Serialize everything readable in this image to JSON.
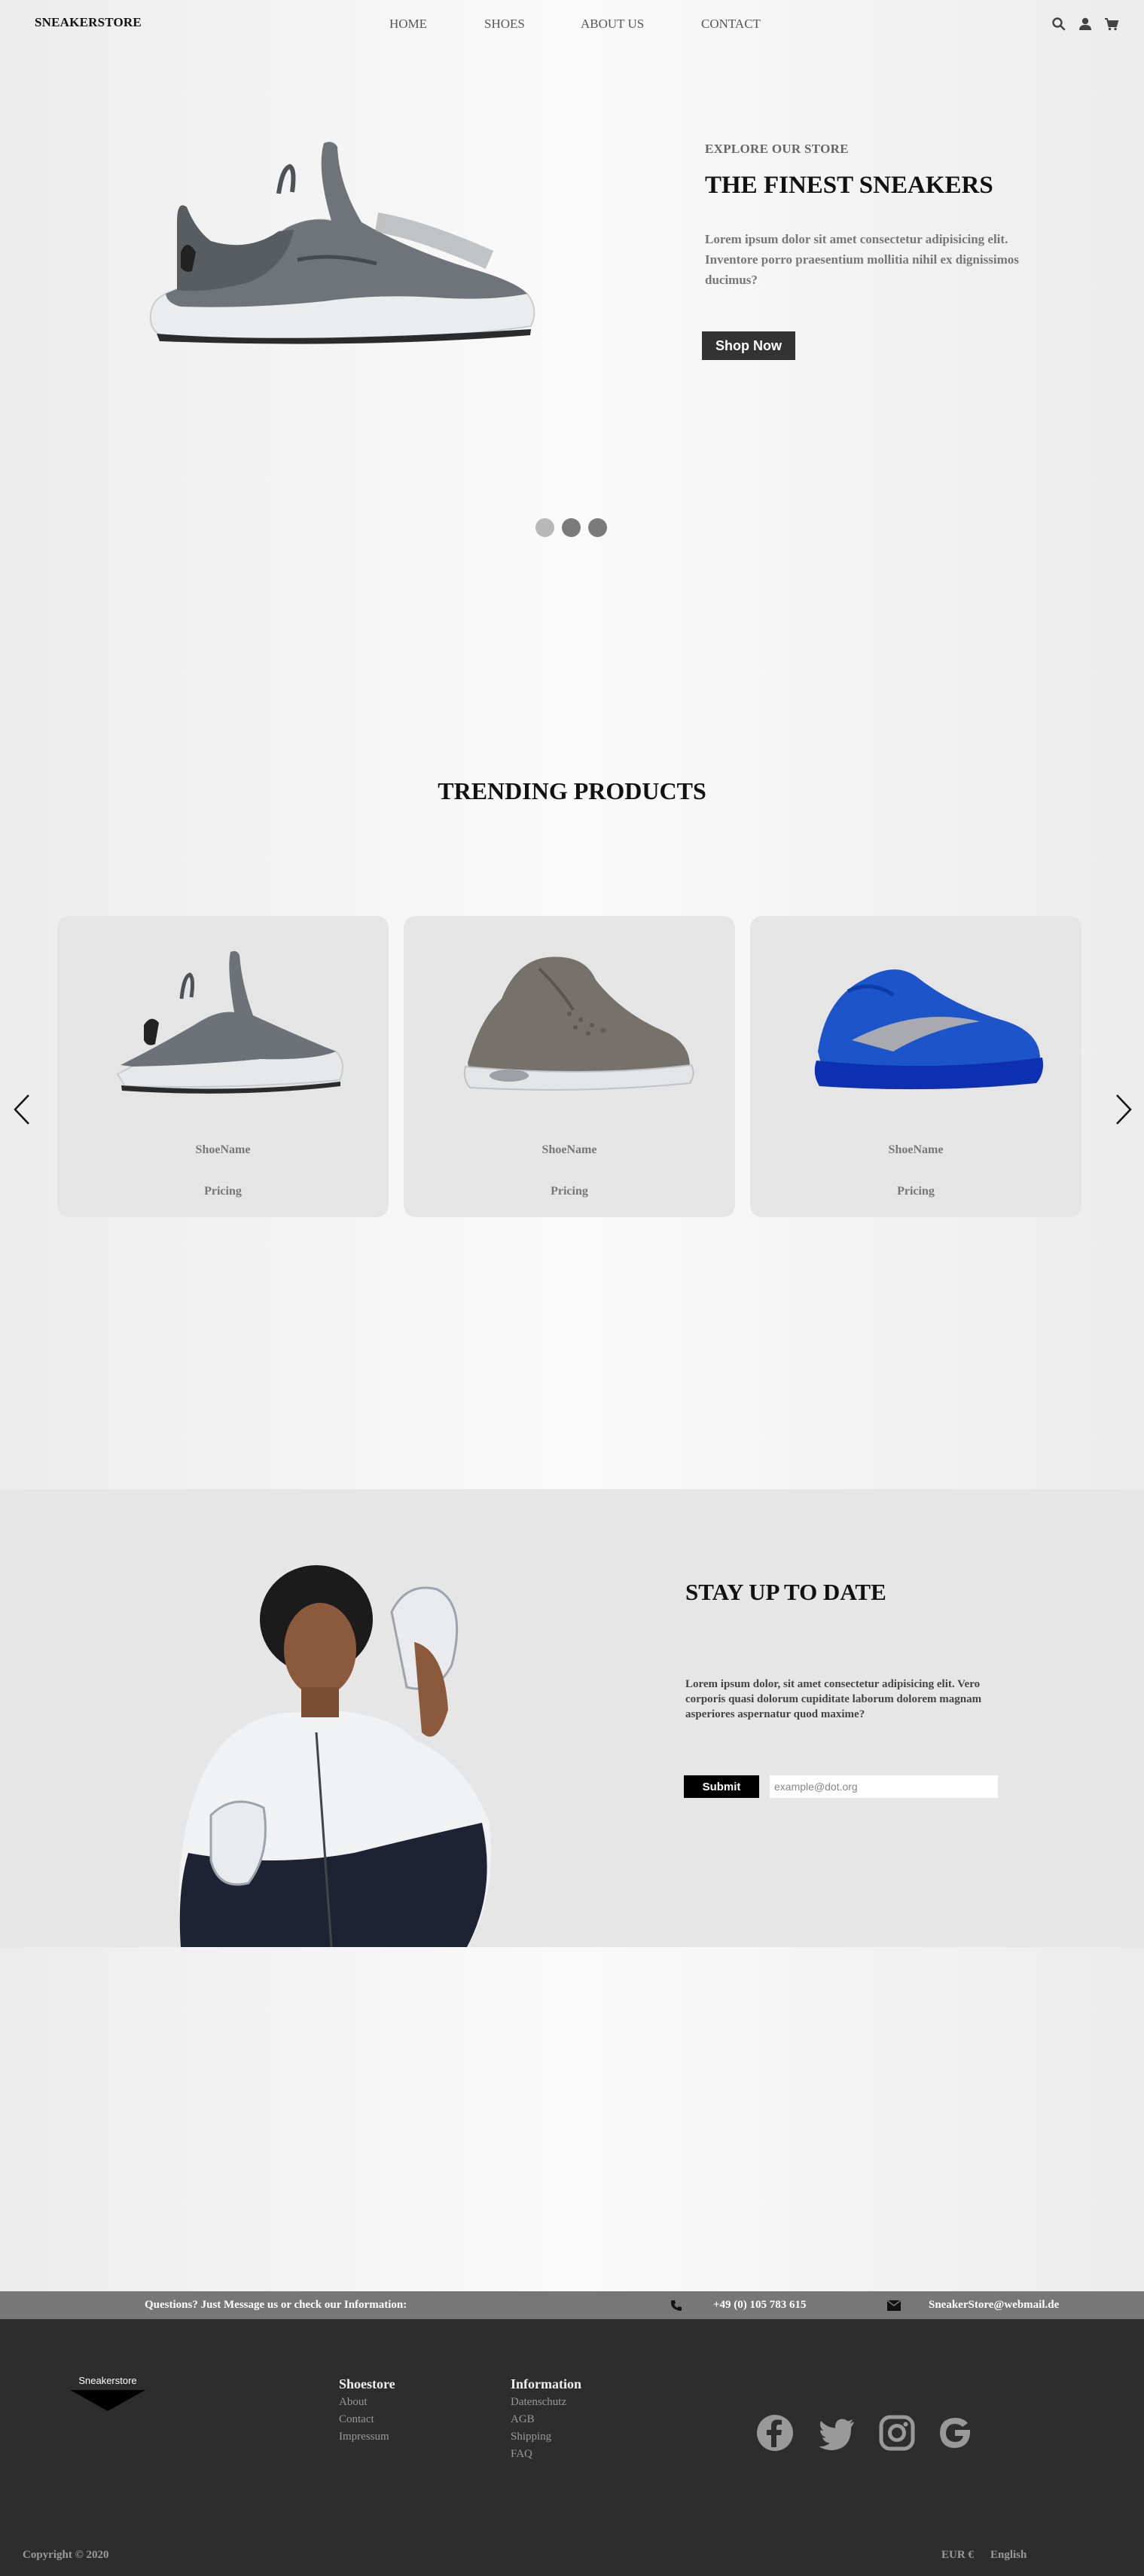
{
  "header": {
    "logo": "SNEAKERSTORE",
    "nav": [
      "HOME",
      "SHOES",
      "ABOUT US",
      "CONTACT"
    ]
  },
  "hero": {
    "eyebrow": "EXPLORE OUR STORE",
    "title": "THE FINEST SNEAKERS",
    "text": "Lorem ipsum dolor sit amet consectetur adipisicing elit. Inventore porro praesentium mollitia nihil ex dignissimos ducimus?",
    "button": "Shop Now"
  },
  "trending": {
    "title": "TRENDING PRODUCTS",
    "products": [
      {
        "name": "ShoeName",
        "price": "Pricing",
        "color": "#6c7277"
      },
      {
        "name": "ShoeName",
        "price": "Pricing",
        "color": "#76716a"
      },
      {
        "name": "ShoeName",
        "price": "Pricing",
        "color": "#1b55c9"
      }
    ]
  },
  "newsletter": {
    "title": "STAY UP TO DATE",
    "text": "Lorem ipsum dolor, sit amet consectetur adipisicing elit. Vero corporis quasi dolorum cupiditate laborum dolorem magnam asperiores aspernatur quod maxime?",
    "submit": "Submit",
    "placeholder": "example@dot.org"
  },
  "contact": {
    "message": "Questions? Just Message us or check our Information:",
    "phone": "+49 (0) 105 783 615",
    "email": "SneakerStore@webmail.de"
  },
  "footer": {
    "logo_text": "Sneakerstore",
    "col1": {
      "title": "Shoestore",
      "links": [
        "About",
        "Contact",
        "Impressum"
      ]
    },
    "col2": {
      "title": "Information",
      "links": [
        "Datenschutz",
        "AGB",
        "Shipping",
        "FAQ"
      ]
    },
    "social": [
      "facebook-icon",
      "twitter-icon",
      "instagram-icon",
      "google-icon"
    ],
    "copyright": "Copyright © 2020",
    "currency": "EUR €",
    "language": "English"
  }
}
